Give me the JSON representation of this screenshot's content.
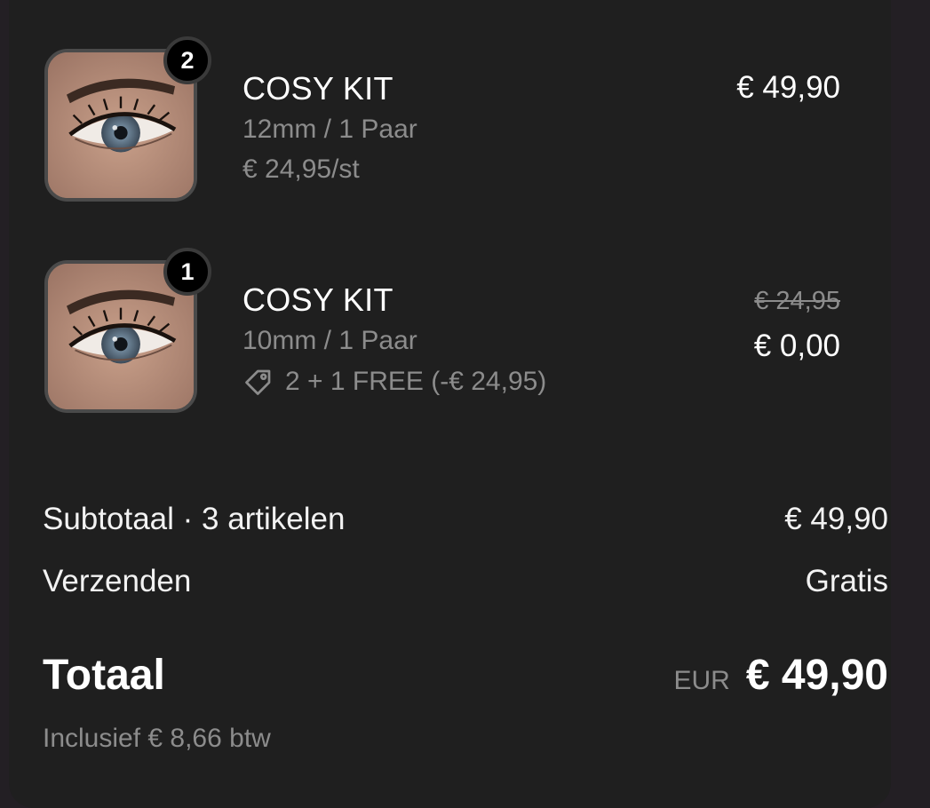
{
  "cart": {
    "items": [
      {
        "quantity": "2",
        "name": "COSY KIT",
        "variant": "12mm / 1 Paar",
        "unit_price": "€ 24,95/st",
        "price": "€ 49,90"
      },
      {
        "quantity": "1",
        "name": "COSY KIT",
        "variant": "10mm / 1 Paar",
        "promo": "2 + 1 FREE (-€ 24,95)",
        "original_price": "€ 24,95",
        "price": "€ 0,00"
      }
    ]
  },
  "summary": {
    "subtotal_label": "Subtotaal · 3 artikelen",
    "subtotal_value": "€ 49,90",
    "shipping_label": "Verzenden",
    "shipping_value": "Gratis",
    "total_label": "Totaal",
    "currency": "EUR",
    "total_value": "€ 49,90",
    "tax_note": "Inclusief € 8,66 btw"
  },
  "colors": {
    "background": "#231f24",
    "panel": "#1f1f1f",
    "text_primary": "#ffffff",
    "text_secondary": "#8c8c8c"
  },
  "icons": {
    "promo": "tag-icon"
  }
}
